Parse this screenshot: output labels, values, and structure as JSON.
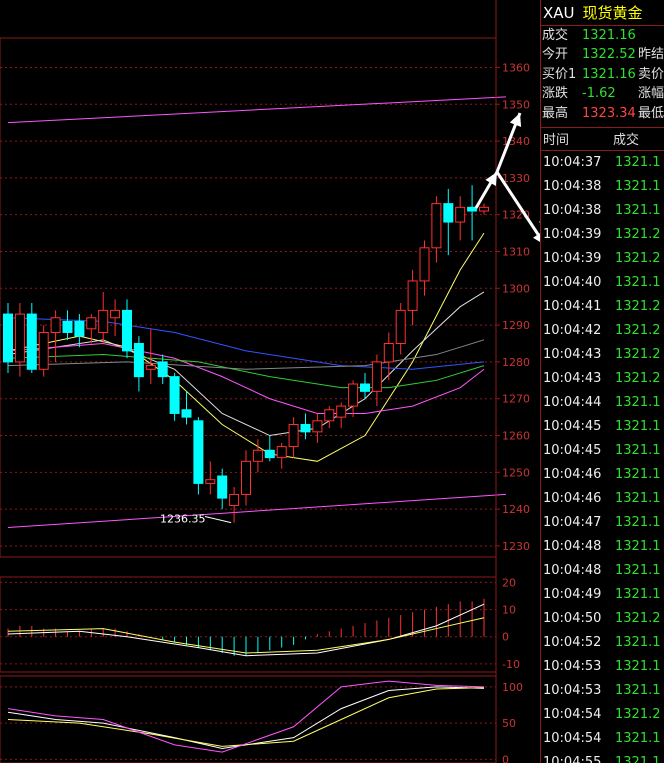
{
  "symbol": {
    "code": "XAU",
    "name": "现货黄金"
  },
  "quote": [
    {
      "label": "成交",
      "value": "1321.16",
      "color": "#2ee02e",
      "extra": ""
    },
    {
      "label": "今开",
      "value": "1322.52",
      "color": "#2ee02e",
      "extra": "昨结"
    },
    {
      "label": "买价1",
      "value": "1321.16",
      "color": "#2ee02e",
      "extra": "卖价"
    },
    {
      "label": "涨跌",
      "value": "-1.62",
      "color": "#2ee02e",
      "extra": "涨幅"
    },
    {
      "label": "最高",
      "value": "1323.34",
      "color": "#ff4444",
      "extra": "最低"
    }
  ],
  "ticks_header": {
    "time": "时间",
    "trade": "成交"
  },
  "ticks": [
    {
      "time": "10:04:37",
      "price": "1321.1"
    },
    {
      "time": "10:04:38",
      "price": "1321.1"
    },
    {
      "time": "10:04:38",
      "price": "1321.1"
    },
    {
      "time": "10:04:39",
      "price": "1321.2"
    },
    {
      "time": "10:04:39",
      "price": "1321.2"
    },
    {
      "time": "10:04:40",
      "price": "1321.1"
    },
    {
      "time": "10:04:41",
      "price": "1321.2"
    },
    {
      "time": "10:04:42",
      "price": "1321.2"
    },
    {
      "time": "10:04:43",
      "price": "1321.2"
    },
    {
      "time": "10:04:43",
      "price": "1321.2"
    },
    {
      "time": "10:04:44",
      "price": "1321.1"
    },
    {
      "time": "10:04:45",
      "price": "1321.1"
    },
    {
      "time": "10:04:45",
      "price": "1321.1"
    },
    {
      "time": "10:04:46",
      "price": "1321.1"
    },
    {
      "time": "10:04:46",
      "price": "1321.1"
    },
    {
      "time": "10:04:47",
      "price": "1321.1"
    },
    {
      "time": "10:04:48",
      "price": "1321.1"
    },
    {
      "time": "10:04:48",
      "price": "1321.1"
    },
    {
      "time": "10:04:49",
      "price": "1321.1"
    },
    {
      "time": "10:04:50",
      "price": "1321.2"
    },
    {
      "time": "10:04:52",
      "price": "1321.1"
    },
    {
      "time": "10:04:53",
      "price": "1321.1"
    },
    {
      "time": "10:04:53",
      "price": "1321.1"
    },
    {
      "time": "10:04:54",
      "price": "1321.2"
    },
    {
      "time": "10:04:54",
      "price": "1321.1"
    },
    {
      "time": "10:04:55",
      "price": "1321.1"
    }
  ],
  "colors": {
    "up": "#ff3030",
    "down": "#00ffff",
    "grid": "#8b1a1a",
    "axis_text": "#cc3333"
  },
  "chart_data": {
    "type": "candlestick",
    "price_axis": {
      "ticks": [
        1360,
        1350,
        1340,
        1330,
        1320,
        1310,
        1300,
        1290,
        1280,
        1270,
        1260,
        1250,
        1240,
        1230
      ],
      "range": [
        1227,
        1368
      ]
    },
    "low_label": "1236.35",
    "candles": [
      {
        "o": 1293,
        "h": 1296,
        "l": 1277,
        "c": 1280
      },
      {
        "o": 1280,
        "h": 1296,
        "l": 1276,
        "c": 1293
      },
      {
        "o": 1293,
        "h": 1296,
        "l": 1277,
        "c": 1278
      },
      {
        "o": 1278,
        "h": 1290,
        "l": 1276,
        "c": 1288
      },
      {
        "o": 1288,
        "h": 1294,
        "l": 1280,
        "c": 1292
      },
      {
        "o": 1291,
        "h": 1294,
        "l": 1286,
        "c": 1288
      },
      {
        "o": 1291,
        "h": 1293,
        "l": 1284,
        "c": 1287
      },
      {
        "o": 1289,
        "h": 1293,
        "l": 1285,
        "c": 1292
      },
      {
        "o": 1288,
        "h": 1299,
        "l": 1285,
        "c": 1294
      },
      {
        "o": 1292,
        "h": 1297,
        "l": 1287,
        "c": 1294
      },
      {
        "o": 1294,
        "h": 1297,
        "l": 1281,
        "c": 1283
      },
      {
        "o": 1285,
        "h": 1287,
        "l": 1272,
        "c": 1276
      },
      {
        "o": 1278,
        "h": 1289,
        "l": 1274,
        "c": 1279
      },
      {
        "o": 1280,
        "h": 1282,
        "l": 1274,
        "c": 1276
      },
      {
        "o": 1276,
        "h": 1277,
        "l": 1264,
        "c": 1266
      },
      {
        "o": 1267,
        "h": 1272,
        "l": 1263,
        "c": 1265
      },
      {
        "o": 1264,
        "h": 1265,
        "l": 1244,
        "c": 1247
      },
      {
        "o": 1247,
        "h": 1253,
        "l": 1244,
        "c": 1248
      },
      {
        "o": 1249,
        "h": 1251,
        "l": 1240,
        "c": 1243
      },
      {
        "o": 1241,
        "h": 1246,
        "l": 1236.35,
        "c": 1244
      },
      {
        "o": 1244,
        "h": 1256,
        "l": 1241,
        "c": 1253
      },
      {
        "o": 1253,
        "h": 1259,
        "l": 1250,
        "c": 1256
      },
      {
        "o": 1256,
        "h": 1260,
        "l": 1253,
        "c": 1254
      },
      {
        "o": 1254,
        "h": 1258,
        "l": 1251,
        "c": 1257
      },
      {
        "o": 1257,
        "h": 1265,
        "l": 1254,
        "c": 1263
      },
      {
        "o": 1263,
        "h": 1266,
        "l": 1259,
        "c": 1261
      },
      {
        "o": 1261,
        "h": 1266,
        "l": 1258,
        "c": 1264
      },
      {
        "o": 1264,
        "h": 1268,
        "l": 1262,
        "c": 1267
      },
      {
        "o": 1265,
        "h": 1269,
        "l": 1262,
        "c": 1268
      },
      {
        "o": 1268,
        "h": 1275,
        "l": 1265,
        "c": 1274
      },
      {
        "o": 1274,
        "h": 1277,
        "l": 1270,
        "c": 1272
      },
      {
        "o": 1272,
        "h": 1282,
        "l": 1268,
        "c": 1280
      },
      {
        "o": 1280,
        "h": 1288,
        "l": 1275,
        "c": 1285
      },
      {
        "o": 1285,
        "h": 1296,
        "l": 1282,
        "c": 1294
      },
      {
        "o": 1294,
        "h": 1305,
        "l": 1290,
        "c": 1302
      },
      {
        "o": 1302,
        "h": 1313,
        "l": 1298,
        "c": 1311
      },
      {
        "o": 1311,
        "h": 1325,
        "l": 1307,
        "c": 1323
      },
      {
        "o": 1323,
        "h": 1327,
        "l": 1309,
        "c": 1318
      },
      {
        "o": 1318,
        "h": 1325,
        "l": 1313,
        "c": 1322
      },
      {
        "o": 1322,
        "h": 1328,
        "l": 1313,
        "c": 1321
      },
      {
        "o": 1321,
        "h": 1323,
        "l": 1320,
        "c": 1322
      }
    ],
    "ma_lines": [
      {
        "color": "#ffff66",
        "points": [
          [
            0,
            1283
          ],
          [
            6,
            1287
          ],
          [
            10,
            1284
          ],
          [
            14,
            1275
          ],
          [
            18,
            1263
          ],
          [
            22,
            1255
          ],
          [
            26,
            1253
          ],
          [
            30,
            1260
          ],
          [
            34,
            1280
          ],
          [
            38,
            1305
          ],
          [
            40,
            1315
          ]
        ]
      },
      {
        "color": "#dddddd",
        "points": [
          [
            0,
            1282
          ],
          [
            8,
            1286
          ],
          [
            14,
            1278
          ],
          [
            18,
            1266
          ],
          [
            22,
            1260
          ],
          [
            26,
            1262
          ],
          [
            30,
            1270
          ],
          [
            34,
            1283
          ],
          [
            38,
            1295
          ],
          [
            40,
            1299
          ]
        ]
      },
      {
        "color": "#ff55ff",
        "points": [
          [
            0,
            1283
          ],
          [
            8,
            1285
          ],
          [
            14,
            1281
          ],
          [
            18,
            1276
          ],
          [
            22,
            1270
          ],
          [
            26,
            1266
          ],
          [
            30,
            1266
          ],
          [
            34,
            1268
          ],
          [
            38,
            1273
          ],
          [
            40,
            1278
          ]
        ]
      },
      {
        "color": "#33cc33",
        "points": [
          [
            0,
            1281
          ],
          [
            8,
            1282
          ],
          [
            16,
            1280
          ],
          [
            22,
            1276
          ],
          [
            28,
            1273
          ],
          [
            32,
            1273
          ],
          [
            36,
            1275
          ],
          [
            40,
            1279
          ]
        ]
      },
      {
        "color": "#3355ff",
        "points": [
          [
            0,
            1292
          ],
          [
            8,
            1291
          ],
          [
            14,
            1288
          ],
          [
            20,
            1283
          ],
          [
            28,
            1279
          ],
          [
            34,
            1278
          ],
          [
            40,
            1280
          ]
        ]
      },
      {
        "color": "#888888",
        "points": [
          [
            0,
            1279
          ],
          [
            10,
            1280
          ],
          [
            20,
            1278
          ],
          [
            30,
            1279
          ],
          [
            36,
            1282
          ],
          [
            40,
            1286
          ]
        ]
      }
    ],
    "channel_lines": [
      {
        "color": "#ff55ff",
        "from": [
          0,
          1345
        ],
        "to": [
          41,
          1352
        ]
      },
      {
        "color": "#ff55ff",
        "from": [
          0,
          1235
        ],
        "to": [
          41,
          1244
        ]
      }
    ],
    "macd": {
      "ticks": [
        20,
        10,
        0,
        -10
      ],
      "range": [
        -13,
        22
      ],
      "bars": [
        3,
        4,
        4,
        3,
        3,
        2,
        2,
        3,
        3,
        3,
        2,
        1,
        0,
        -1,
        -2,
        -3,
        -4,
        -5,
        -6,
        -7,
        -7,
        -6,
        -5,
        -4,
        -3,
        -1,
        1,
        2,
        3,
        4,
        5,
        6,
        7,
        8,
        9,
        10,
        11,
        12,
        13,
        13,
        14
      ],
      "dif": [
        [
          0,
          1
        ],
        [
          6,
          2
        ],
        [
          10,
          0
        ],
        [
          16,
          -4
        ],
        [
          20,
          -7
        ],
        [
          26,
          -6
        ],
        [
          32,
          -1
        ],
        [
          36,
          4
        ],
        [
          40,
          12
        ]
      ],
      "dea": [
        [
          0,
          2
        ],
        [
          8,
          3
        ],
        [
          14,
          -2
        ],
        [
          20,
          -6
        ],
        [
          26,
          -5
        ],
        [
          32,
          -1
        ],
        [
          36,
          3
        ],
        [
          40,
          7
        ]
      ]
    },
    "kdj": {
      "ticks": [
        100,
        50,
        0
      ],
      "range": [
        -5,
        115
      ],
      "k": [
        [
          0,
          65
        ],
        [
          4,
          55
        ],
        [
          8,
          50
        ],
        [
          14,
          30
        ],
        [
          18,
          15
        ],
        [
          24,
          30
        ],
        [
          28,
          70
        ],
        [
          32,
          95
        ],
        [
          36,
          100
        ],
        [
          40,
          98
        ]
      ],
      "d": [
        [
          0,
          55
        ],
        [
          6,
          50
        ],
        [
          12,
          35
        ],
        [
          18,
          18
        ],
        [
          24,
          25
        ],
        [
          28,
          55
        ],
        [
          32,
          85
        ],
        [
          36,
          97
        ],
        [
          40,
          99
        ]
      ],
      "j": [
        [
          0,
          70
        ],
        [
          4,
          60
        ],
        [
          8,
          55
        ],
        [
          14,
          20
        ],
        [
          18,
          10
        ],
        [
          24,
          45
        ],
        [
          28,
          100
        ],
        [
          32,
          108
        ],
        [
          36,
          102
        ],
        [
          40,
          100
        ]
      ]
    }
  }
}
